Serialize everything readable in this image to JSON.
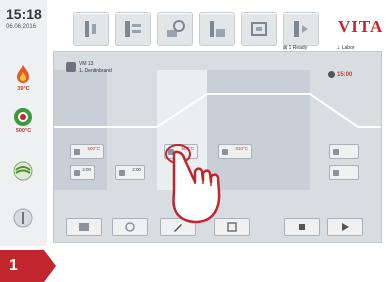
{
  "clock": {
    "time": "15:18",
    "date": "06.06.2016"
  },
  "sidebar": {
    "items": [
      {
        "name": "flame-icon",
        "label": "39°C"
      },
      {
        "name": "target-icon",
        "label": "500°C"
      },
      {
        "name": "vacuum-icon",
        "label": ""
      },
      {
        "name": "power-icon",
        "label": ""
      }
    ]
  },
  "topbar": {
    "buttons": [
      "program-icon",
      "program-list-icon",
      "settings-icon",
      "calibration-icon",
      "info-icon",
      "service-icon"
    ],
    "logo": "VITA",
    "status": {
      "ready": "1 Ready",
      "user": "Labor"
    }
  },
  "program": {
    "id": "VM 13",
    "name": "1. Dentinbrand",
    "timer": "15:00"
  },
  "params": {
    "col0_top": "500°C",
    "col0_a": "2:00",
    "col0_b": "2:00",
    "col2_top": "500°C",
    "col3_top": "910°C",
    "col5_a": "",
    "col5_b": ""
  },
  "colors": {
    "accent": "#c63b2e",
    "brand": "#c8242b",
    "callout": "#c0262c"
  },
  "callout": {
    "step": "1"
  }
}
